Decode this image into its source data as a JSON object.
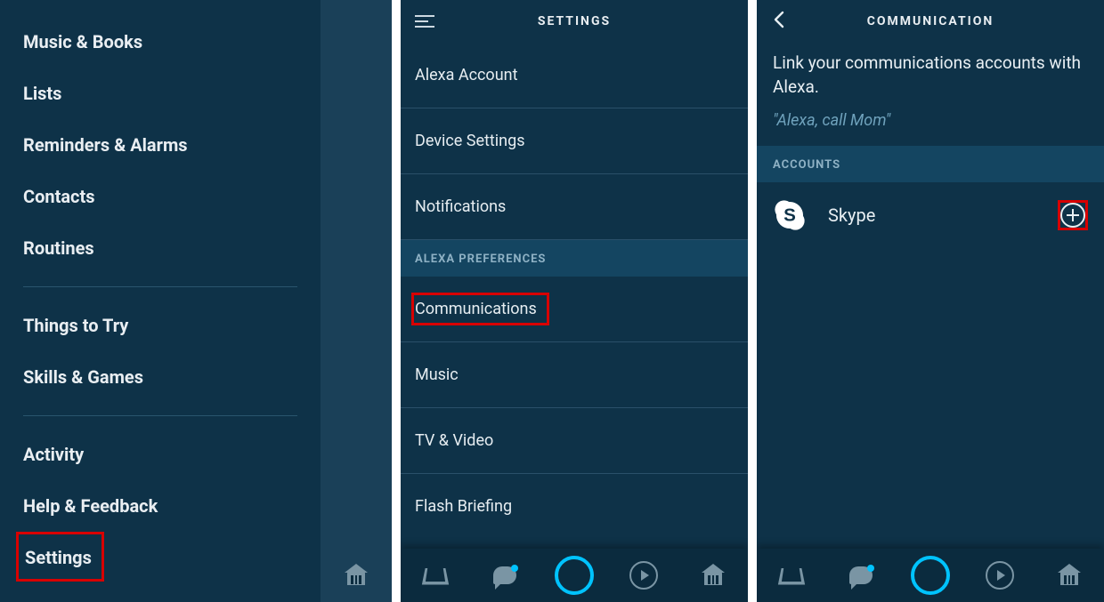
{
  "panel1": {
    "menu": [
      "Music & Books",
      "Lists",
      "Reminders & Alarms",
      "Contacts",
      "Routines"
    ],
    "menu2": [
      "Things to Try",
      "Skills & Games"
    ],
    "menu3": [
      "Activity",
      "Help & Feedback"
    ],
    "settings_label": "Settings"
  },
  "panel2": {
    "header": "SETTINGS",
    "rows_top": [
      "Alexa Account",
      "Device Settings",
      "Notifications"
    ],
    "section_label": "ALEXA PREFERENCES",
    "communications_label": "Communications",
    "rows_bottom": [
      "Music",
      "TV & Video",
      "Flash Briefing"
    ]
  },
  "panel3": {
    "header": "COMMUNICATION",
    "intro": "Link your communications accounts with Alexa.",
    "example": "\"Alexa, call Mom\"",
    "accounts_label": "ACCOUNTS",
    "account_name": "Skype"
  }
}
